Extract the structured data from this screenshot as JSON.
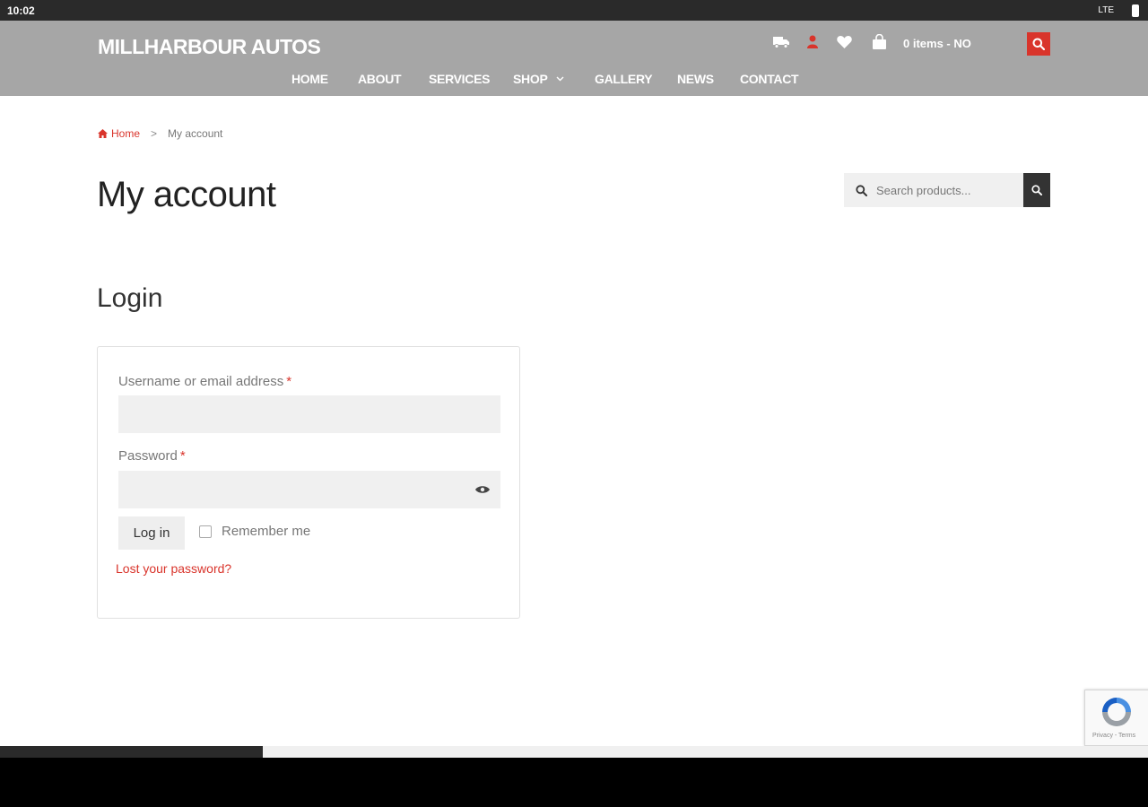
{
  "status_bar": {
    "time": "10:02",
    "network": "LTE"
  },
  "header": {
    "site_title": "MILLHARBOUR  AUTOS",
    "cart_label": "0 items - NO",
    "icons": [
      "truck-icon",
      "user-icon",
      "heart-icon",
      "shopping-bag-icon",
      "search-icon"
    ],
    "colors": {
      "header_bg": "#a6a6a6",
      "accent": "#d9342b"
    }
  },
  "nav": {
    "items": [
      {
        "label": "HOME"
      },
      {
        "label": "ABOUT"
      },
      {
        "label": "SERVICES"
      },
      {
        "label": "SHOP"
      },
      {
        "label": "GALLERY"
      },
      {
        "label": "NEWS"
      },
      {
        "label": "CONTACT"
      }
    ]
  },
  "breadcrumb": {
    "home": "Home",
    "separator": ">",
    "current": "My account"
  },
  "page": {
    "title": "My account"
  },
  "product_search": {
    "placeholder": "Search products..."
  },
  "login": {
    "heading": "Login",
    "username_label": "Username or email address",
    "password_label": "Password",
    "required_mark": "*",
    "username_value": "",
    "password_value": "",
    "submit_label": "Log in",
    "remember_label": "Remember me",
    "remember_checked": false,
    "lost_password": "Lost your password?"
  },
  "recaptcha": {
    "links": "Privacy - Terms"
  }
}
